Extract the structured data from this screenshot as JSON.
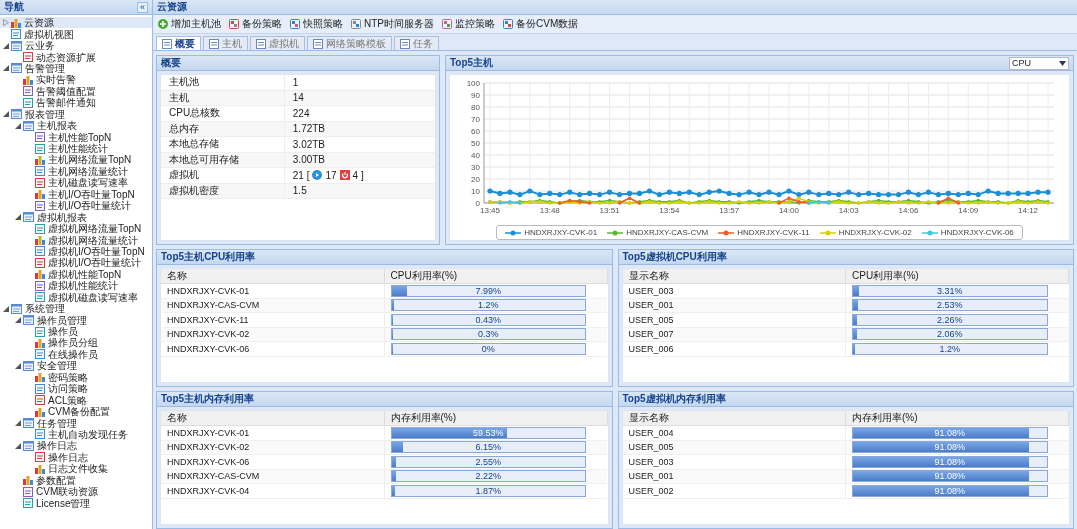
{
  "sidebar": {
    "title": "导航",
    "collapse_glyph": "«",
    "items": [
      {
        "label": "云资源",
        "selected": true,
        "expanded": false
      },
      {
        "label": "虚拟机视图",
        "selected": false
      },
      {
        "label": "云业务",
        "selected": false,
        "expanded": true,
        "children": [
          {
            "label": "动态资源扩展",
            "selected": false
          }
        ]
      },
      {
        "label": "告警管理",
        "selected": false,
        "expanded": true,
        "children": [
          {
            "label": "实时告警",
            "selected": false
          },
          {
            "label": "告警阈值配置",
            "selected": false
          },
          {
            "label": "告警邮件通知",
            "selected": false
          }
        ]
      },
      {
        "label": "报表管理",
        "selected": false,
        "expanded": true,
        "children": [
          {
            "label": "主机报表",
            "selected": false,
            "expanded": true,
            "children": [
              {
                "label": "主机性能TopN",
                "selected": false
              },
              {
                "label": "主机性能统计",
                "selected": false
              },
              {
                "label": "主机网络流量TopN",
                "selected": false
              },
              {
                "label": "主机网络流量统计",
                "selected": false
              },
              {
                "label": "主机磁盘读写速率",
                "selected": false
              },
              {
                "label": "主机I/O吞吐量TopN",
                "selected": false
              },
              {
                "label": "主机I/O吞吐量统计",
                "selected": false
              }
            ]
          },
          {
            "label": "虚拟机报表",
            "selected": false,
            "expanded": true,
            "children": [
              {
                "label": "虚拟机网络流量TopN",
                "selected": false
              },
              {
                "label": "虚拟机网络流量统计",
                "selected": false
              },
              {
                "label": "虚拟机I/O吞吐量TopN",
                "selected": false
              },
              {
                "label": "虚拟机I/O吞吐量统计",
                "selected": false
              },
              {
                "label": "虚拟机性能TopN",
                "selected": false
              },
              {
                "label": "虚拟机性能统计",
                "selected": false
              },
              {
                "label": "虚拟机磁盘读写速率",
                "selected": false
              }
            ]
          }
        ]
      },
      {
        "label": "系统管理",
        "selected": false,
        "expanded": true,
        "children": [
          {
            "label": "操作员管理",
            "selected": false,
            "expanded": true,
            "children": [
              {
                "label": "操作员",
                "selected": false
              },
              {
                "label": "操作员分组",
                "selected": false
              },
              {
                "label": "在线操作员",
                "selected": false
              }
            ]
          },
          {
            "label": "安全管理",
            "selected": false,
            "expanded": true,
            "children": [
              {
                "label": "密码策略",
                "selected": false
              },
              {
                "label": "访问策略",
                "selected": false
              },
              {
                "label": "ACL策略",
                "selected": false
              },
              {
                "label": "CVM备份配置",
                "selected": false
              }
            ]
          },
          {
            "label": "任务管理",
            "selected": false,
            "expanded": true,
            "children": [
              {
                "label": "主机自动发现任务",
                "selected": false
              }
            ]
          },
          {
            "label": "操作日志",
            "selected": false,
            "expanded": true,
            "children": [
              {
                "label": "操作日志",
                "selected": false
              },
              {
                "label": "日志文件收集",
                "selected": false
              }
            ]
          },
          {
            "label": "参数配置",
            "selected": false
          },
          {
            "label": "CVM联动资源",
            "selected": false
          },
          {
            "label": "License管理",
            "selected": false
          }
        ]
      }
    ]
  },
  "main": {
    "title": "云资源",
    "toolbar": [
      "增加主机池",
      "备份策略",
      "快照策略",
      "NTP时间服务器",
      "监控策略",
      "备份CVM数据"
    ],
    "tabs": [
      {
        "label": "概要",
        "selected": true
      },
      {
        "label": "主机",
        "selected": false
      },
      {
        "label": "虚拟机",
        "selected": false
      },
      {
        "label": "网络策略模板",
        "selected": false
      },
      {
        "label": "任务",
        "selected": false
      }
    ],
    "summary": {
      "title": "概要",
      "rows": [
        {
          "label": "主机池",
          "value": "1"
        },
        {
          "label": "主机",
          "value": "14"
        },
        {
          "label": "CPU总核数",
          "value": "224"
        },
        {
          "label": "总内存",
          "value": "1.72TB"
        },
        {
          "label": "本地总存储",
          "value": "3.02TB"
        },
        {
          "label": "本地总可用存储",
          "value": "3.00TB"
        },
        {
          "label": "虚拟机",
          "value": "21 [",
          "running": "17",
          "stopped": "4 ]"
        },
        {
          "label": "虚拟机密度",
          "value": "1.5"
        }
      ]
    },
    "top_hosts": {
      "title": "Top5主机",
      "metric": "CPU",
      "chart_data": {
        "type": "line",
        "ylim": [
          0,
          100
        ],
        "yticks": [
          0,
          10,
          20,
          30,
          40,
          50,
          60,
          70,
          80,
          90,
          100
        ],
        "grid": true,
        "legend": true,
        "categories": [
          "13:45",
          null,
          null,
          null,
          null,
          null,
          "13:48",
          null,
          null,
          null,
          null,
          null,
          "13:51",
          null,
          null,
          null,
          null,
          null,
          "13:54",
          null,
          null,
          null,
          null,
          null,
          "13:57",
          null,
          null,
          null,
          null,
          null,
          "14:00",
          null,
          null,
          null,
          null,
          null,
          "14:03",
          null,
          null,
          null,
          null,
          null,
          "14:06",
          null,
          null,
          null,
          null,
          null,
          "14:09",
          null,
          null,
          null,
          null,
          null,
          "14:12",
          null,
          null
        ],
        "series": [
          {
            "name": "HNDXRJXY-CVK-01",
            "color": "#1b8ed6",
            "values": [
              10,
              8,
              9,
              7,
              10,
              7,
              8,
              7,
              9,
              7,
              8,
              7,
              9,
              7,
              8,
              8,
              10,
              7,
              9,
              8,
              9,
              7,
              9,
              10,
              8,
              7,
              9,
              7,
              9,
              7,
              10,
              7,
              9,
              7,
              8,
              7,
              9,
              7,
              8,
              7,
              7,
              7,
              9,
              7,
              9,
              7,
              8,
              7,
              8,
              7,
              10,
              8,
              8,
              8,
              8,
              9,
              9
            ]
          },
          {
            "name": "HNDXRJXY-CAS-CVM",
            "color": "#5cb82f",
            "values": [
              1,
              1,
              0,
              1,
              1,
              2,
              1,
              0,
              1,
              2,
              1,
              1,
              2,
              1,
              0,
              1,
              2,
              1,
              1,
              2,
              0,
              1,
              2,
              1,
              1,
              0,
              1,
              2,
              1,
              1,
              1,
              0,
              2,
              1,
              1,
              2,
              1,
              0,
              1,
              2,
              1,
              1,
              2,
              1,
              0,
              1,
              2,
              1,
              1,
              2,
              1,
              1,
              0,
              2,
              1,
              2,
              1
            ]
          },
          {
            "name": "HNDXRJXY-CVK-11",
            "color": "#f05a24",
            "values": [
              null,
              null,
              null,
              null,
              null,
              null,
              null,
              0,
              2,
              1,
              0,
              null,
              null,
              0,
              4,
              0,
              null,
              null,
              null,
              null,
              null,
              null,
              null,
              null,
              null,
              null,
              null,
              null,
              null,
              0,
              4,
              1,
              0,
              null,
              null,
              null,
              null,
              null,
              null,
              null,
              null,
              null,
              null,
              null,
              null,
              0,
              4,
              0,
              null,
              null,
              null,
              null,
              null,
              null,
              null,
              null,
              null
            ]
          },
          {
            "name": "HNDXRJXY-CVK-02",
            "color": "#d8d000",
            "values": [
              1,
              1,
              0,
              0,
              1,
              1,
              0,
              0,
              1,
              0,
              1,
              0,
              0,
              1,
              0,
              0,
              1,
              0,
              0,
              1,
              0,
              0,
              1,
              0,
              0,
              1,
              0,
              0,
              1,
              0,
              1,
              4,
              1,
              0,
              0,
              1,
              0,
              0,
              1,
              0,
              0,
              1,
              0,
              0,
              1,
              0,
              0,
              1,
              0,
              0,
              1,
              0,
              0,
              1,
              0,
              1,
              0
            ]
          },
          {
            "name": "HNDXRJXY-CVK-06",
            "color": "#3cc8e0",
            "values": [
              null,
              0,
              1,
              0,
              null,
              null,
              null,
              null,
              null,
              null,
              null,
              null,
              null,
              null,
              null,
              null,
              null,
              null,
              null,
              null,
              null,
              null,
              null,
              null,
              null,
              null,
              null,
              null,
              null,
              null,
              null,
              null,
              0,
              1,
              0,
              null,
              null,
              null,
              null,
              null,
              null,
              null,
              null,
              null,
              null,
              null,
              null,
              null,
              null,
              null,
              null,
              null,
              null,
              null,
              null,
              null,
              null
            ]
          }
        ]
      }
    },
    "grids": [
      {
        "title": "Top5主机CPU利用率",
        "columns": [
          "名称",
          "CPU利用率(%)"
        ],
        "rows": [
          {
            "name": "HNDXRJXY-CVK-01",
            "reading": "7.99%",
            "level": 0.0799
          },
          {
            "name": "HNDXRJXY-CAS-CVM",
            "reading": "1.2%",
            "level": 0.012
          },
          {
            "name": "HNDXRJXY-CVK-11",
            "reading": "0.43%",
            "level": 0.0043
          },
          {
            "name": "HNDXRJXY-CVK-02",
            "reading": "0.3%",
            "level": 0.003
          },
          {
            "name": "HNDXRJXY-CVK-06",
            "reading": "0%",
            "level": 0
          }
        ]
      },
      {
        "title": "Top5虚拟机CPU利用率",
        "columns": [
          "显示名称",
          "CPU利用率(%)"
        ],
        "rows": [
          {
            "name": "USER_003",
            "reading": "3.31%",
            "level": 0.0331
          },
          {
            "name": "USER_001",
            "reading": "2.53%",
            "level": 0.0253
          },
          {
            "name": "USER_005",
            "reading": "2.26%",
            "level": 0.0226
          },
          {
            "name": "USER_007",
            "reading": "2.06%",
            "level": 0.0206
          },
          {
            "name": "USER_006",
            "reading": "1.2%",
            "level": 0.012
          }
        ]
      },
      {
        "title": "Top5主机内存利用率",
        "columns": [
          "名称",
          "内存利用率(%)"
        ],
        "rows": [
          {
            "name": "HNDXRJXY-CVK-01",
            "reading": "59.53%",
            "level": 0.5953
          },
          {
            "name": "HNDXRJXY-CVK-02",
            "reading": "6.15%",
            "level": 0.0615
          },
          {
            "name": "HNDXRJXY-CVK-06",
            "reading": "2.55%",
            "level": 0.0255
          },
          {
            "name": "HNDXRJXY-CAS-CVM",
            "reading": "2.22%",
            "level": 0.0222
          },
          {
            "name": "HNDXRJXY-CVK-04",
            "reading": "1.87%",
            "level": 0.0187
          }
        ]
      },
      {
        "title": "Top5虚拟机内存利用率",
        "columns": [
          "显示名称",
          "内存利用率(%)"
        ],
        "rows": [
          {
            "name": "USER_004",
            "reading": "91.08%",
            "level": 0.9108
          },
          {
            "name": "USER_005",
            "reading": "91.08%",
            "level": 0.9108
          },
          {
            "name": "USER_003",
            "reading": "91.08%",
            "level": 0.9108
          },
          {
            "name": "USER_001",
            "reading": "91.08%",
            "level": 0.9108
          },
          {
            "name": "USER_002",
            "reading": "91.08%",
            "level": 0.9108
          }
        ]
      }
    ]
  }
}
